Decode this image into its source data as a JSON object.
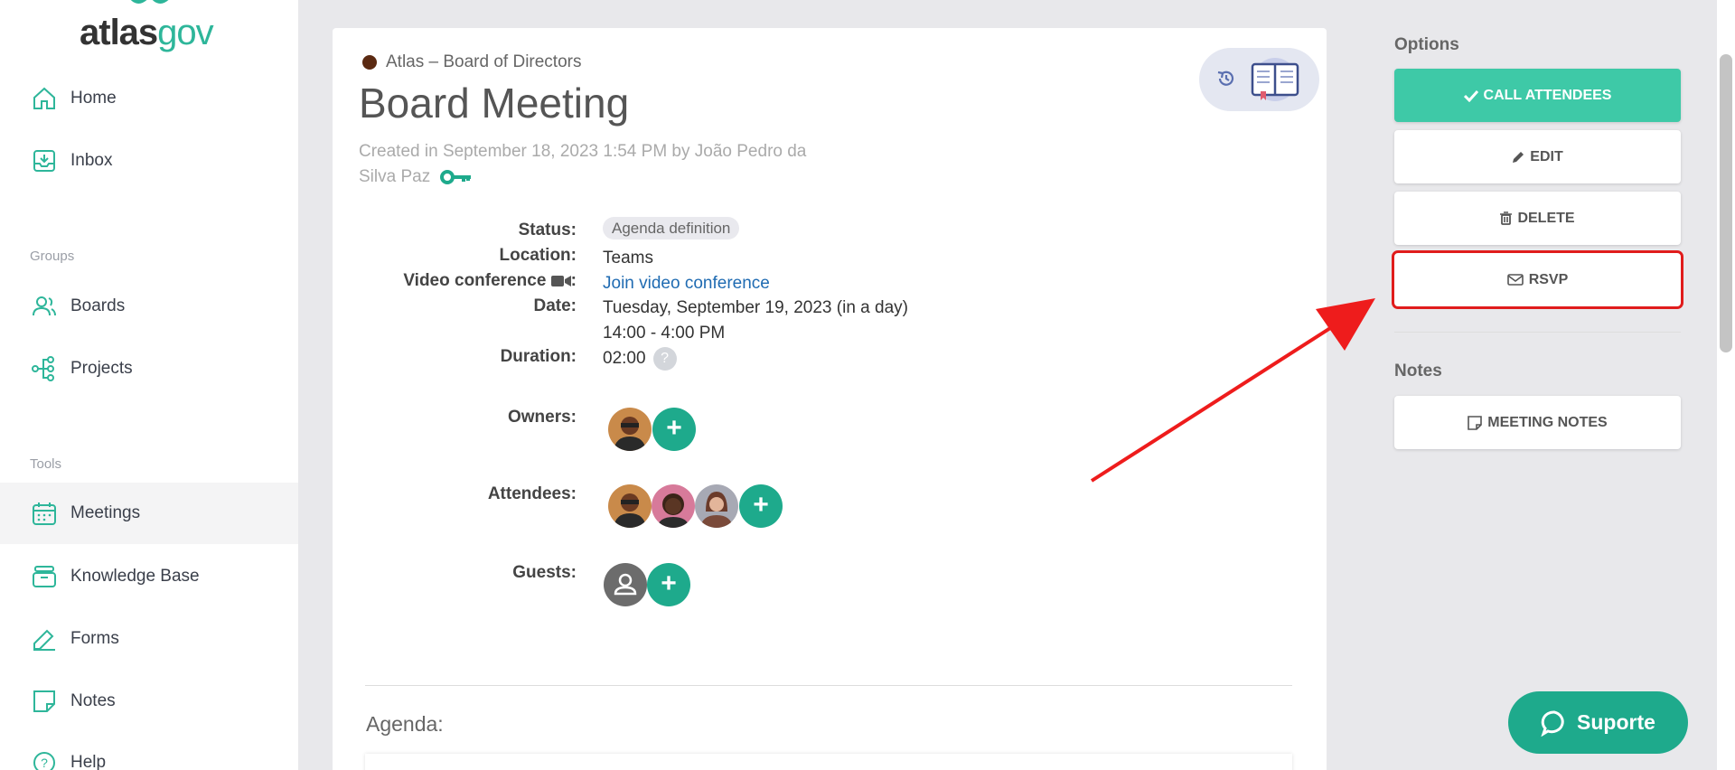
{
  "brand": {
    "name_a": "atlas",
    "name_b": "gov",
    "accent": "#2eb69a"
  },
  "sidebar": {
    "items": [
      {
        "label": "Home",
        "icon": "home-icon"
      },
      {
        "label": "Inbox",
        "icon": "inbox-icon"
      },
      {
        "label": "Boards",
        "icon": "users-icon"
      },
      {
        "label": "Projects",
        "icon": "projects-icon"
      },
      {
        "label": "Meetings",
        "icon": "calendar-icon"
      },
      {
        "label": "Knowledge Base",
        "icon": "archive-icon"
      },
      {
        "label": "Forms",
        "icon": "forms-icon"
      },
      {
        "label": "Notes",
        "icon": "note-icon"
      },
      {
        "label": "Help",
        "icon": "help-icon"
      }
    ],
    "groups": {
      "groups": "Groups",
      "tools": "Tools"
    }
  },
  "meeting": {
    "breadcrumb": "Atlas – Board of Directors",
    "title": "Board Meeting",
    "created": "Created in September 18, 2023 1:54 PM by João Pedro da Silva Paz",
    "labels": {
      "status": "Status:",
      "location": "Location:",
      "video": "Video conference",
      "video_colon": ":",
      "date": "Date:",
      "duration": "Duration:",
      "owners": "Owners:",
      "attendees": "Attendees:",
      "guests": "Guests:"
    },
    "status": "Agenda definition",
    "location": "Teams",
    "video_link": "Join video conference",
    "date": "Tuesday, September 19, 2023  (in a day)",
    "time": "14:00 - 4:00 PM",
    "duration": "02:00",
    "help_mark": "?",
    "plus": "+",
    "agenda_label": "Agenda:"
  },
  "options": {
    "heading": "Options",
    "call_attendees": "CALL ATTENDEES",
    "edit": "EDIT",
    "delete": "DELETE",
    "rsvp": "RSVP",
    "colors": {
      "primary": "#3ec9a7",
      "highlight": "#e01c1c"
    }
  },
  "notes": {
    "heading": "Notes",
    "meeting_notes": "MEETING NOTES"
  },
  "support": {
    "label": "Suporte"
  }
}
